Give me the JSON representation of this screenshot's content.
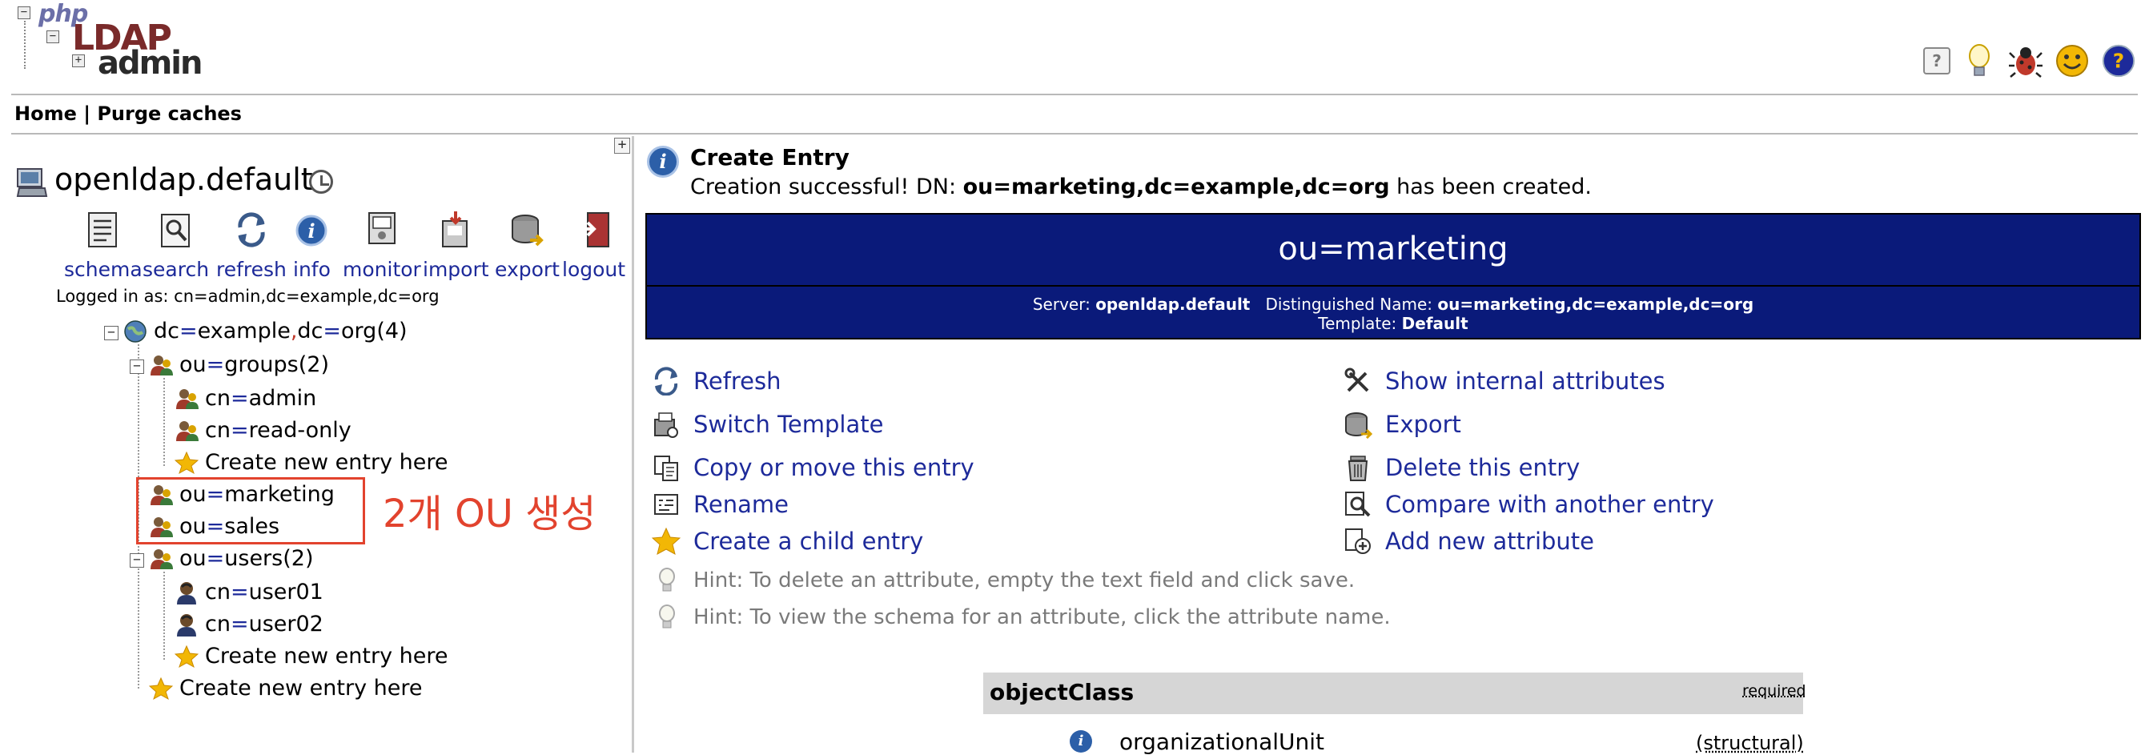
{
  "logo": {
    "php": "php",
    "ldap": "LDAP",
    "admin": "admin"
  },
  "top_icons": [
    {
      "name": "help-icon",
      "glyph": "?",
      "color": "#777777"
    },
    {
      "name": "lightbulb-icon",
      "glyph": "💡",
      "color": "#f2b705"
    },
    {
      "name": "bug-icon",
      "glyph": "🐞",
      "color": "#c0392b"
    },
    {
      "name": "smiley-icon",
      "glyph": "☺",
      "color": "#e0a000"
    },
    {
      "name": "support-icon",
      "glyph": "?",
      "color": "#1d2a9a"
    }
  ],
  "menu": {
    "home": "Home",
    "separator": " | ",
    "purge": "Purge caches"
  },
  "server": {
    "name": "openldap.default"
  },
  "tools": [
    {
      "label": "schema"
    },
    {
      "label": "search"
    },
    {
      "label": "refresh"
    },
    {
      "label": "info"
    },
    {
      "label": "monitor"
    },
    {
      "label": "import"
    },
    {
      "label": "export"
    },
    {
      "label": "logout"
    }
  ],
  "logged_in": "Logged in as: cn=admin,dc=example,dc=org",
  "tree": {
    "root": {
      "a": "dc",
      "eq1": "=",
      "b": "example",
      "comma": ",",
      "c": "dc",
      "eq2": "=",
      "d": "org",
      "count": " (4)"
    },
    "groups": {
      "a": "ou",
      "eq": "=",
      "b": "groups",
      "count": " (2)"
    },
    "admin": {
      "a": "cn",
      "eq": "=",
      "b": "admin"
    },
    "readonly": {
      "a": "cn",
      "eq": "=",
      "b": "read-only"
    },
    "create1": "Create new entry here",
    "marketing": {
      "a": "ou",
      "eq": "=",
      "b": "marketing"
    },
    "sales": {
      "a": "ou",
      "eq": "=",
      "b": "sales"
    },
    "users": {
      "a": "ou",
      "eq": "=",
      "b": "users",
      "count": " (2)"
    },
    "user01": {
      "a": "cn",
      "eq": "=",
      "b": "user01"
    },
    "user02": {
      "a": "cn",
      "eq": "=",
      "b": "user02"
    },
    "create2": "Create new entry here",
    "create3": "Create new entry here"
  },
  "annotation": "2개 OU 생성",
  "message": {
    "title": "Create Entry",
    "prefix": "Creation successful! DN: ",
    "dn": "ou=marketing,dc=example,dc=org",
    "suffix": " has been created."
  },
  "banner": {
    "rdn": "ou=marketing",
    "server_label": "Server: ",
    "server": "openldap.default",
    "dn_label": "Distinguished Name: ",
    "dn": "ou=marketing,dc=example,dc=org",
    "template_label": "Template: ",
    "template": "Default"
  },
  "actions_left": [
    {
      "label": "Refresh"
    },
    {
      "label": "Switch Template"
    },
    {
      "label": "Copy or move this entry"
    },
    {
      "label": "Rename"
    },
    {
      "label": "Create a child entry"
    }
  ],
  "actions_right": [
    {
      "label": "Show internal attributes"
    },
    {
      "label": "Export"
    },
    {
      "label": "Delete this entry"
    },
    {
      "label": "Compare with another entry"
    },
    {
      "label": "Add new attribute"
    }
  ],
  "hints": [
    {
      "text": "Hint: To delete an attribute, empty the text field and click save."
    },
    {
      "text": "Hint: To view the schema for an attribute, click the attribute name."
    }
  ],
  "attribute": {
    "name": "objectClass",
    "required": "required",
    "value": "organizationalUnit",
    "kind": "(structural)"
  },
  "colors": {
    "banner": "#0a1a7a",
    "link": "#1d2a9a",
    "annotation": "#e2432e"
  }
}
